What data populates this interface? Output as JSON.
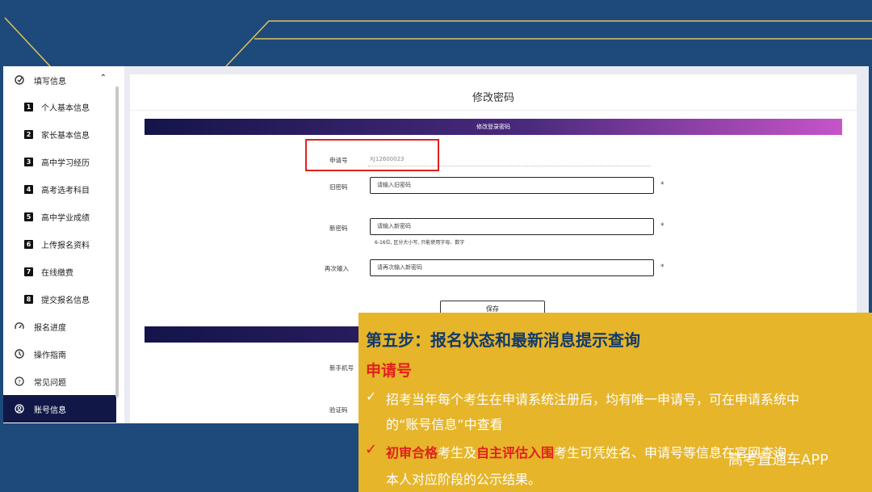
{
  "sidebar": {
    "header": {
      "label": "填写信息",
      "icon": "edit-check-icon",
      "chevron": "⌃"
    },
    "sub_items": [
      {
        "num": "1",
        "label": "个人基本信息"
      },
      {
        "num": "2",
        "label": "家长基本信息"
      },
      {
        "num": "3",
        "label": "高中学习经历"
      },
      {
        "num": "4",
        "label": "高考选考科目"
      },
      {
        "num": "5",
        "label": "高中学业成绩"
      },
      {
        "num": "6",
        "label": "上传报名资料"
      },
      {
        "num": "7",
        "label": "在线缴费"
      },
      {
        "num": "8",
        "label": "提交报名信息"
      }
    ],
    "items": [
      {
        "label": "报名进度",
        "icon": "gauge-icon"
      },
      {
        "label": "操作指南",
        "icon": "compass-icon"
      },
      {
        "label": "常见问题",
        "icon": "help-icon"
      },
      {
        "label": "账号信息",
        "icon": "account-icon"
      }
    ]
  },
  "main": {
    "title": "修改密码",
    "section_banner": "修改登录密码",
    "fields": {
      "app_no_label": "申请号",
      "app_no_value": "XJ12600023",
      "old_pwd_label": "旧密码",
      "old_pwd_placeholder": "请输入旧密码",
      "new_pwd_label": "新密码",
      "new_pwd_placeholder": "请输入新密码",
      "new_pwd_hint": "6-16位, 区分大小写, 只能使用字母、数字",
      "confirm_label": "再次输入",
      "confirm_placeholder": "请再次输入新密码",
      "required_dot": "*"
    },
    "save_label": "保存",
    "phone_label": "新手机号",
    "code_label": "验证码"
  },
  "overlay": {
    "title": "第五步：报名状态和最新消息提示查询",
    "subtitle": "申请号",
    "check": "✓",
    "bullet1_line1": "招考当年每个考生在申请系统注册后，均有唯一申请号，可在申请系统中",
    "bullet1_line2": "的“账号信息”中查看",
    "bullet2_red1": "初审合格",
    "bullet2_mid": "考生及",
    "bullet2_red2": "自主评估入围",
    "bullet2_rest": "考生可凭姓名、申请号等信息在官网查询",
    "bullet2_line2": "本人对应阶段的公示结果。"
  },
  "watermark": "高考直通车APP",
  "colors": {
    "background": "#1d4a7a",
    "accent_line": "#e2c35a",
    "overlay": "#e6b52a",
    "highlight_red": "#e2201c",
    "active_nav": "#111848"
  }
}
